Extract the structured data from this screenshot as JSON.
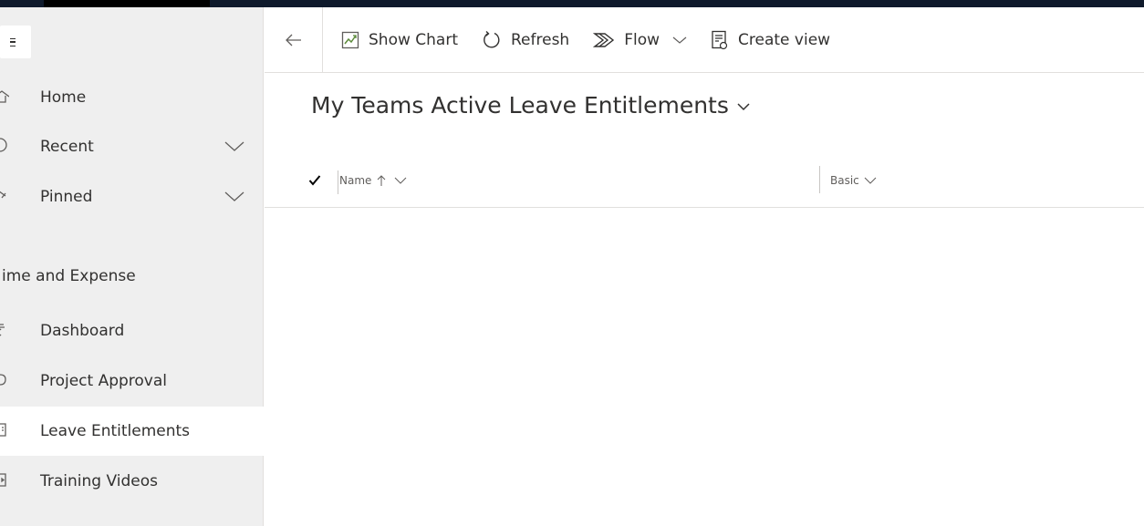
{
  "sidebar": {
    "items": [
      {
        "label": "Home",
        "icon": "home-icon",
        "expandable": false
      },
      {
        "label": "Recent",
        "icon": "recent-icon",
        "expandable": true
      },
      {
        "label": "Pinned",
        "icon": "pin-icon",
        "expandable": true
      }
    ],
    "section_title": "ime and Expense",
    "section_items": [
      {
        "label": "Dashboard",
        "icon": "dashboard-icon",
        "active": false
      },
      {
        "label": "Project Approval",
        "icon": "project-approval-icon",
        "active": false
      },
      {
        "label": "Leave Entitlements",
        "icon": "leave-entitlements-icon",
        "active": true
      },
      {
        "label": "Training Videos",
        "icon": "training-videos-icon",
        "active": false
      }
    ]
  },
  "toolbar": {
    "show_chart": "Show Chart",
    "refresh": "Refresh",
    "flow": "Flow",
    "create_view": "Create view"
  },
  "view": {
    "title": "My Teams Active Leave Entitlements"
  },
  "grid": {
    "columns": [
      {
        "label": "Name",
        "sort": "ascending"
      },
      {
        "label": "Basic"
      }
    ]
  },
  "colors": {
    "sidebar_bg": "#efefef",
    "active_item_bg": "#ffffff",
    "top_strip": "#0f1a2c",
    "text": "#323130",
    "chart_icon_accent": "#5c8a3a"
  }
}
